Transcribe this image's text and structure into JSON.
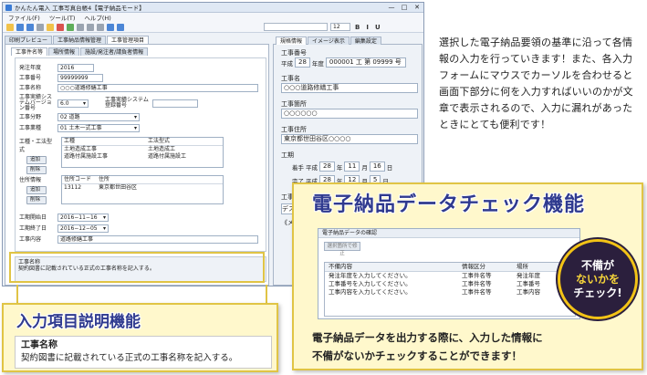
{
  "window": {
    "title": "かんたん電入 工事写真台帳4【電子納品モード】",
    "controls": [
      "—",
      "□",
      "✕"
    ]
  },
  "menu": [
    "ファイル(F)",
    "ツール(T)",
    "ヘルプ(H)"
  ],
  "toolbar": {
    "font_size": "12",
    "format": [
      "B",
      "I",
      "U"
    ]
  },
  "top_tabs": [
    "印刷プレビュー",
    "工事納品情報管理",
    "工事管理項目"
  ],
  "sub_tabs": [
    "工事件名等",
    "場所情報",
    "施設/発注者/請負者情報"
  ],
  "form": {
    "fields": [
      {
        "label": "発注年度",
        "value": "2016"
      },
      {
        "label": "工事番号",
        "value": "99999999"
      },
      {
        "label": "工事名称",
        "value": "○○○道路修繕工事"
      },
      {
        "label": "工事実績システムバージョン番号",
        "value": "6.0"
      },
      {
        "label": "工事実績システム登録番号",
        "value": ""
      },
      {
        "label": "工事分野",
        "value": "02 道路"
      },
      {
        "label": "工事業種",
        "value": "01 土木一式工事"
      }
    ],
    "kousyu": {
      "label": "工種・工法型式",
      "add_label": "追加",
      "delete_label": "削除",
      "headers": [
        "工種",
        "工法型式"
      ],
      "rows": [
        [
          "土地造成工事",
          "土地造成工"
        ],
        [
          "道路付属施設工事",
          "道路付属施設工"
        ]
      ]
    },
    "address": {
      "label": "住所情報",
      "add_label": "追加",
      "delete_label": "削除",
      "headers": [
        "住所コード",
        "住所"
      ],
      "rows": [
        [
          "13112",
          "東京都世田谷区"
        ]
      ]
    },
    "dates": [
      {
        "label": "工期開始日",
        "value": "2016−11−16"
      },
      {
        "label": "工期終了日",
        "value": "2016−12−05"
      },
      {
        "label": "工事内容",
        "value": "道路修繕工事"
      }
    ],
    "desc_title": "工事名称",
    "desc_text": "契約図書に記載されている正式の工事名称を記入する。"
  },
  "right_pane": {
    "tabs": [
      "規格情報",
      "イメージ表示",
      "編集設定"
    ],
    "kouji_bangou_label": "工事番号",
    "heisei": "平成",
    "year": "28",
    "year_suffix": "年度",
    "number": "000001 工 第 09999 号",
    "kouji_mei_label": "工事名",
    "kouji_mei": "○○○道路修繕工事",
    "basho_label": "工事箇所",
    "basho": "○○○○○○",
    "jusho_label": "工事住所",
    "jusho": "東京都世田谷区○○○○",
    "kouki_label": "工期",
    "start_prefix": "着手",
    "start_era": "平成",
    "start": [
      "28",
      "11",
      "16"
    ],
    "end_prefix": "完了",
    "end_era": "平成",
    "end": [
      "28",
      "12",
      "5"
    ],
    "date_units": [
      "年",
      "月",
      "日"
    ],
    "extra1": "工事",
    "extra2": "デス",
    "extra3": "《メモ"
  },
  "side_text": "選択した電子納品要領の基準に沿って各情報の入力を行っていきます！また、各入力フォームにマウスでカーソルを合わせると画面下部分に何を入力すればいいのかが文章で表示されるので、入力に漏れがあったときにとても便利です！",
  "check_panel": {
    "title": "電子納品データチェック機能",
    "dialog_title": "電子納品データの確認",
    "dialog_button": "選択箇所で修正",
    "headers": [
      "不備内容",
      "情報区分",
      "場所"
    ],
    "rows": [
      [
        "発注年度を入力してください。",
        "工事件名等",
        "発注年度"
      ],
      [
        "工事番号を入力してください。",
        "工事件名等",
        "工事番号"
      ],
      [
        "工事内容を入力してください。",
        "工事件名等",
        "工事内容"
      ]
    ],
    "footer_1": "電子納品データを出力する際に、入力した情報に",
    "footer_2": "不備がないかチェックすることができます！"
  },
  "badge": {
    "line1": "不備が",
    "line2": "ないかを",
    "line3": "チェック!"
  },
  "callout": {
    "title": "入力項目説明機能",
    "item_title": "工事名称",
    "item_desc": "契約図書に記載されている正式の工事名称を記入する。"
  }
}
